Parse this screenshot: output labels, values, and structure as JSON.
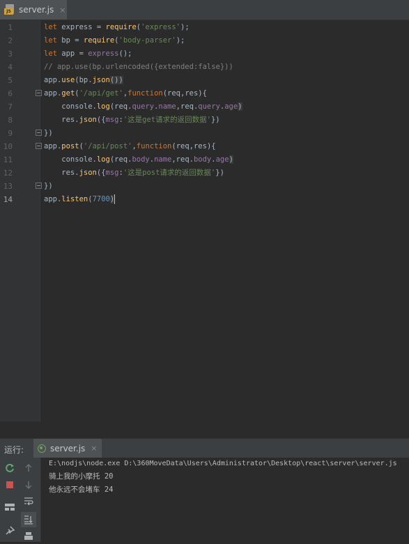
{
  "editor_tab": {
    "label": "server.js",
    "icon": "js-file-icon",
    "close": "×"
  },
  "lines": [
    {
      "n": "1"
    },
    {
      "n": "2"
    },
    {
      "n": "3"
    },
    {
      "n": "4"
    },
    {
      "n": "5"
    },
    {
      "n": "6"
    },
    {
      "n": "7"
    },
    {
      "n": "8"
    },
    {
      "n": "9"
    },
    {
      "n": "10"
    },
    {
      "n": "11"
    },
    {
      "n": "12"
    },
    {
      "n": "13"
    },
    {
      "n": "14"
    }
  ],
  "code": {
    "l1": [
      "let",
      " express = ",
      "require",
      "(",
      "'express'",
      ");"
    ],
    "l2": [
      "let",
      " bp = ",
      "require",
      "(",
      "'body-parser'",
      ");"
    ],
    "l3": [
      "let",
      " app = ",
      "express",
      "();"
    ],
    "l4": "// app.use(bp.urlencoded({extended:false}))",
    "l5": [
      "app.",
      "use",
      "(bp.",
      "json",
      "())"
    ],
    "l6": [
      "app.",
      "get",
      "(",
      "'/api/get'",
      ",",
      "function",
      "(req,res){"
    ],
    "l7": [
      "    console.",
      "log",
      "(req.",
      "query",
      ".",
      "name",
      ",req.",
      "query",
      ".",
      "age",
      ")"
    ],
    "l8": [
      "    res.",
      "json",
      "({",
      "msg",
      ":",
      "'这是get请求的返回数据'",
      "})"
    ],
    "l9": "})",
    "l10": [
      "app.",
      "post",
      "(",
      "'/api/post'",
      ",",
      "function",
      "(req,res){"
    ],
    "l11": [
      "    console.",
      "log",
      "(req.",
      "body",
      ".",
      "name",
      ",req.",
      "body",
      ".",
      "age",
      ")"
    ],
    "l12": [
      "    res.",
      "json",
      "({",
      "msg",
      ":",
      "'这是post请求的返回数据'",
      "})"
    ],
    "l13": "})",
    "l14": [
      "app.",
      "listen",
      "(",
      "7700",
      ")"
    ]
  },
  "run_panel": {
    "title": "运行:",
    "tab_label": "server.js",
    "tab_close": "×",
    "console": [
      "E:\\nodjs\\node.exe D:\\360MoveData\\Users\\Administrator\\Desktop\\react\\server\\server.js",
      "骑上我的小摩托 20",
      "他永远不会堵车 24"
    ]
  },
  "colors": {
    "keyword": "#cc7832",
    "string": "#6a8759",
    "function": "#ffc66d",
    "property": "#9876aa",
    "number": "#6897bb",
    "comment": "#808080",
    "rerun_icon": "#59a869",
    "stop_icon": "#c75450"
  }
}
